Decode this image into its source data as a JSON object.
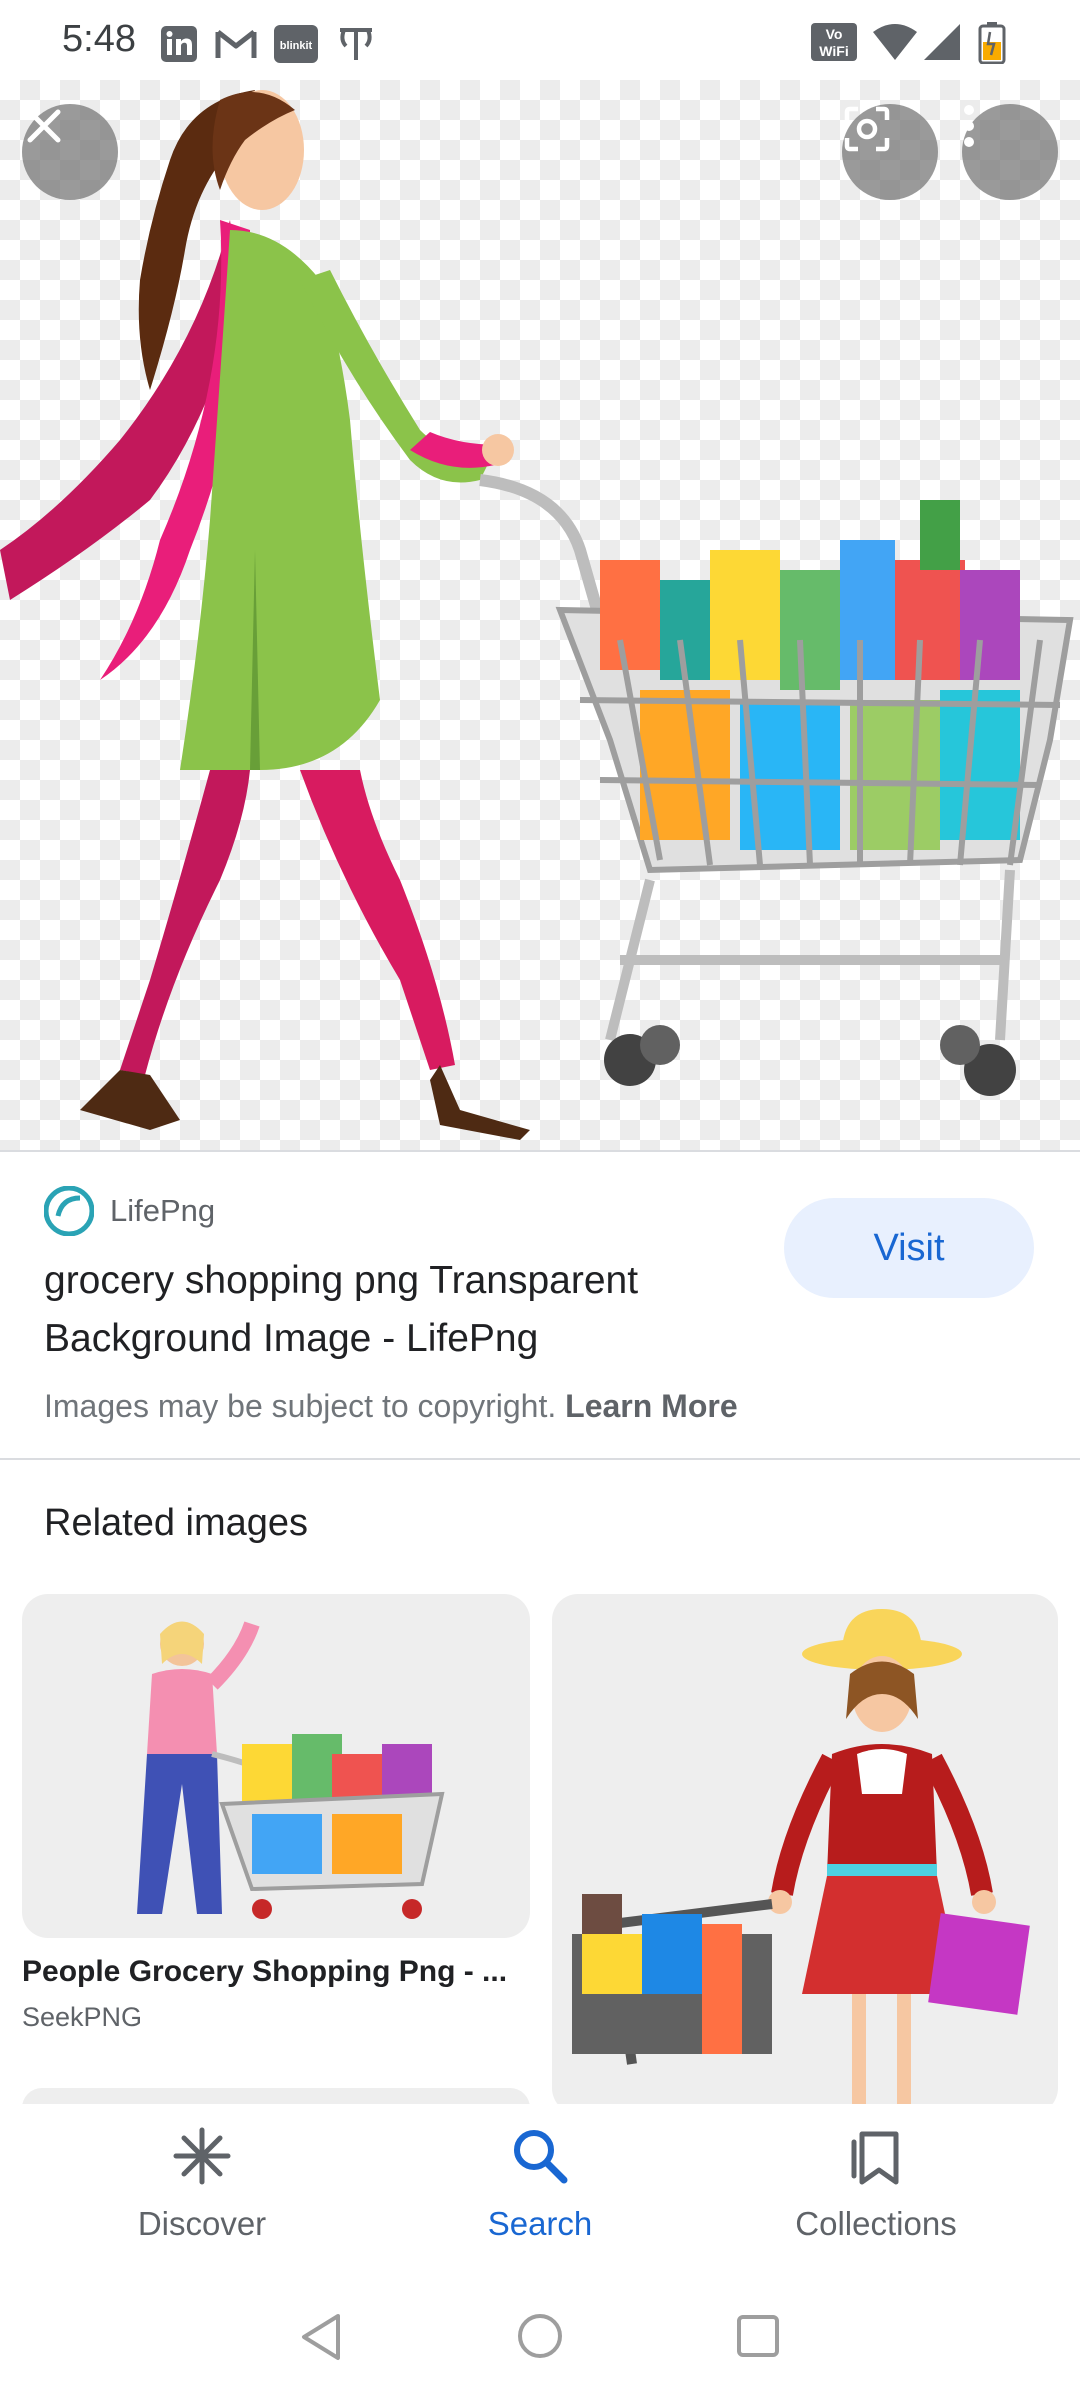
{
  "status_bar": {
    "time": "5:48",
    "left_icons": [
      "linkedin-icon",
      "gmail-icon",
      "blinkit-icon",
      "text-icon"
    ],
    "blinkit_label": "blinkit",
    "vowifi_line1": "Vo",
    "vowifi_line2": "WiFi",
    "right_icons": [
      "vowifi-icon",
      "wifi-icon",
      "signal-icon",
      "battery-icon"
    ]
  },
  "viewer": {
    "close_icon": "close-icon",
    "lens_icon": "lens-icon",
    "more_icon": "more-vert-icon"
  },
  "result": {
    "source_name": "LifePng",
    "visit_label": "Visit",
    "title": "grocery shopping png Transparent Background Image - LifePng",
    "copyright_text": "Images may be subject to copyright.",
    "learn_more": "Learn More"
  },
  "related": {
    "heading": "Related images",
    "items": [
      {
        "title": "People Grocery Shopping Png - ...",
        "source": "SeekPNG"
      },
      {
        "title": "",
        "source": ""
      }
    ]
  },
  "bottom_nav": {
    "items": [
      {
        "label": "Discover",
        "icon": "asterisk-icon",
        "active": false
      },
      {
        "label": "Search",
        "icon": "search-icon",
        "active": true
      },
      {
        "label": "Collections",
        "icon": "collections-icon",
        "active": false
      }
    ]
  },
  "system_nav": {
    "icons": [
      "back-icon",
      "home-icon",
      "recents-icon"
    ]
  },
  "colors": {
    "accent": "#1967d2",
    "visit_bg": "#e8f0fe",
    "text_primary": "#202124",
    "text_secondary": "#5f6368"
  }
}
